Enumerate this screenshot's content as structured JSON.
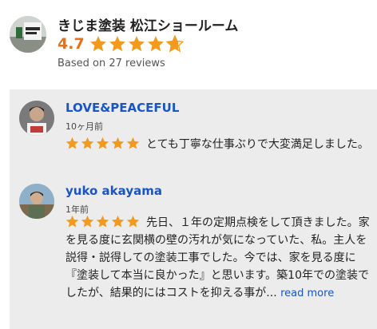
{
  "business": {
    "name": "きじま塗装 松江ショールーム",
    "rating": "4.7",
    "rating_value": 4.7,
    "rating_max": 5,
    "reviews_summary": "Based on 27 reviews",
    "logo_icon": "business-logo"
  },
  "colors": {
    "star": "#f29a1e",
    "rating_text": "#e7711b",
    "link": "#1a55c4",
    "panel_bg": "#ececec"
  },
  "reviews": [
    {
      "author": "LOVE&PEACEFUL",
      "date": "10ヶ月前",
      "stars": 5,
      "text": "とても丁寧な仕事ぶりで大変満足しました。"
    },
    {
      "author": "yuko akayama",
      "date": "1年前",
      "stars": 5,
      "text": "先日、１年の定期点検をして頂きました。家を見る度に玄関横の壁の汚れが気になっていた、私。主人を説得・説得しての塗装工事でした。今では、家を見る度に『塗装して本当に良かった』と思います。築10年での塗装でしたが、結果的にはコストを抑える事が...",
      "read_more": "read more"
    }
  ]
}
